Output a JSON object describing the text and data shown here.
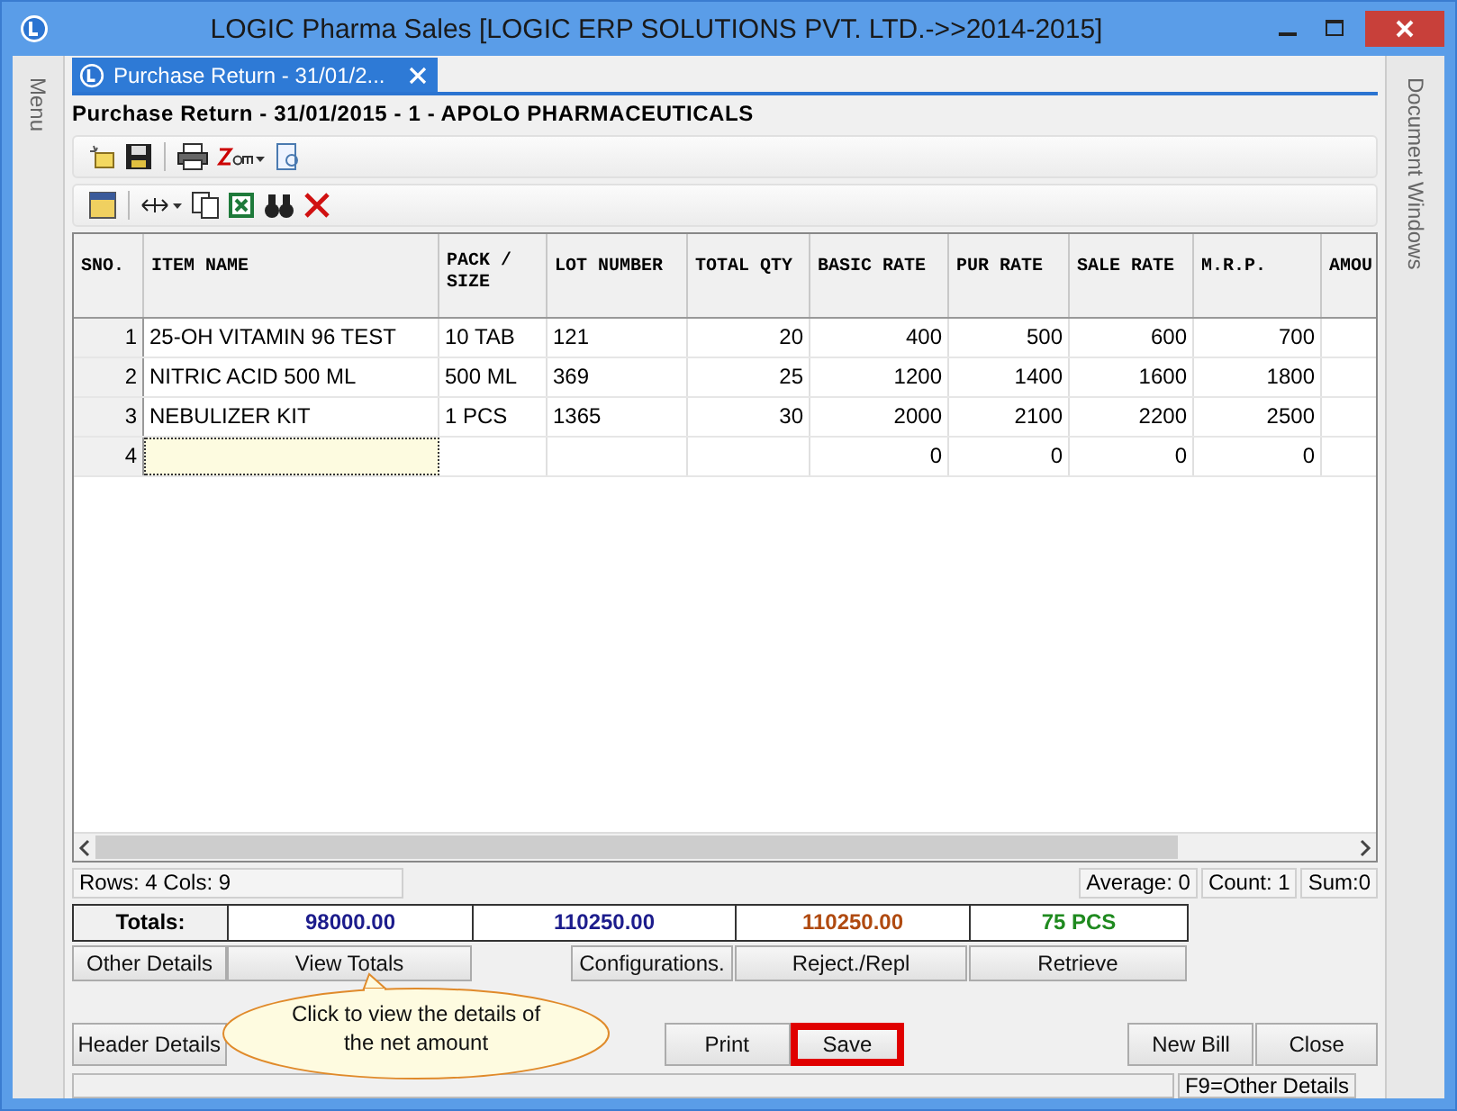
{
  "window": {
    "title": "LOGIC Pharma Sales  [LOGIC ERP SOLUTIONS PVT. LTD.->>2014-2015]"
  },
  "left_panel": {
    "label": "Menu"
  },
  "right_panel": {
    "label": "Document Windows"
  },
  "tabs": [
    {
      "label": "Purchase Return - 31/01/2...",
      "selected": true
    }
  ],
  "heading": "Purchase Return - 31/01/2015 - 1 - APOLO PHARMACEUTICALS",
  "grid": {
    "columns": [
      {
        "label": "SNO.",
        "kind": "number"
      },
      {
        "label": "ITEM NAME",
        "kind": "text"
      },
      {
        "label": "PACK / SIZE",
        "kind": "text"
      },
      {
        "label": "LOT NUMBER",
        "kind": "text"
      },
      {
        "label": "TOTAL QTY",
        "kind": "number"
      },
      {
        "label": "BASIC RATE",
        "kind": "number"
      },
      {
        "label": "PUR RATE",
        "kind": "number"
      },
      {
        "label": "SALE RATE",
        "kind": "number"
      },
      {
        "label": "M.R.P.",
        "kind": "number"
      },
      {
        "label": "AMOU",
        "kind": "number"
      }
    ],
    "rows": [
      {
        "cells": [
          "1",
          "25-OH VITAMIN 96 TEST",
          "10 TAB",
          "121",
          "20",
          "400",
          "500",
          "600",
          "700",
          null
        ],
        "editing": false
      },
      {
        "cells": [
          "2",
          "NITRIC ACID 500 ML",
          "500 ML",
          "369",
          "25",
          "1200",
          "1400",
          "1600",
          "1800",
          null
        ],
        "editing": false
      },
      {
        "cells": [
          "3",
          "NEBULIZER KIT",
          "1 PCS",
          "1365",
          "30",
          "2000",
          "2100",
          "2200",
          "2500",
          null
        ],
        "editing": false
      },
      {
        "cells": [
          "4",
          null,
          null,
          null,
          null,
          "0",
          "0",
          "0",
          "0",
          null
        ],
        "editing": true
      }
    ]
  },
  "status": {
    "rows_cols": "Rows: 4  Cols: 9",
    "average": "Average: 0",
    "count": "Count: 1",
    "sum": "Sum:0"
  },
  "totals": {
    "label": "Totals:",
    "values": [
      {
        "text": "98000.00",
        "color": "#1c1c8c"
      },
      {
        "text": "110250.00",
        "color": "#1c1c8c"
      },
      {
        "text": "110250.00",
        "color": "#b04a10"
      },
      {
        "text": "75 PCS",
        "color": "#1f8a1f"
      }
    ]
  },
  "action_buttons": [
    {
      "label": "Other Details"
    },
    {
      "label": "View Totals"
    },
    {
      "label": "Configurations."
    },
    {
      "label": "Reject./Repl"
    },
    {
      "label": "Retrieve"
    }
  ],
  "tooltip": "Click to view the details of the net amount",
  "bottom_buttons": [
    {
      "label": "Header Details",
      "highlighted": false
    },
    {
      "label": "Print",
      "highlighted": false
    },
    {
      "label": "Save",
      "highlighted": true
    },
    {
      "label": "New Bill",
      "highlighted": false
    },
    {
      "label": "Close",
      "highlighted": false
    }
  ],
  "status_bar": {
    "hint": "F9=Other Details"
  }
}
